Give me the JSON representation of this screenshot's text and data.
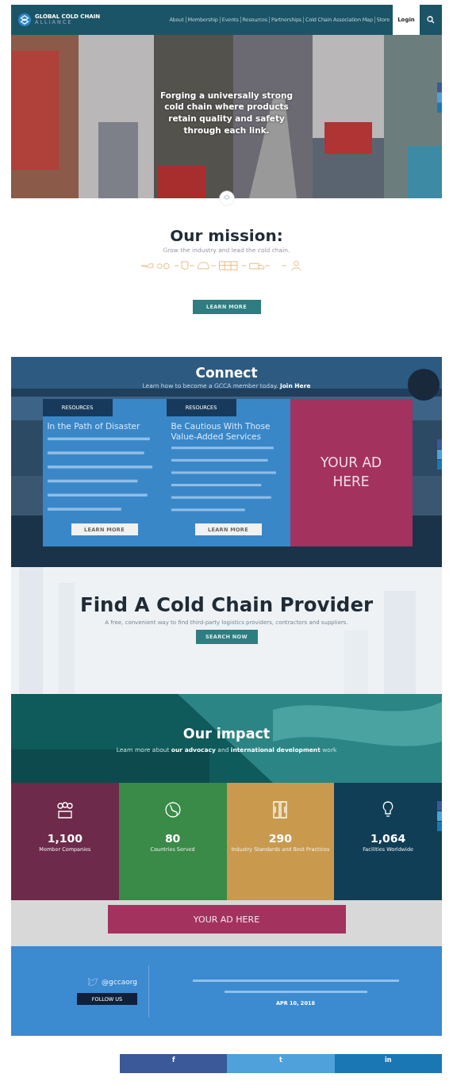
{
  "header": {
    "logo_line1": "GLOBAL COLD CHAIN",
    "logo_line2": "ALLIANCE",
    "nav": [
      "About",
      "Membership",
      "Events",
      "Resources",
      "Partnerships",
      "Cold Chain Association Map",
      "Store"
    ],
    "login": "Login"
  },
  "hero": {
    "kind": "picture",
    "tagline": "Forging a universally strong cold chain where products retain quality and safety through each link."
  },
  "mission": {
    "title": "Our mission:",
    "subtitle": "Grow the industry and lead the cold chain.",
    "button": "LEARN MORE"
  },
  "connect": {
    "title": "Connect",
    "subtitle": "Learn how to become a GCCA member today. **Join Here**",
    "cards": [
      {
        "kind": "article",
        "tag": "RESOURCES",
        "title": "In the Path of Disaster",
        "button": "LEARN MORE"
      },
      {
        "kind": "article",
        "tag": "RESOURCES",
        "title": "Be Cautious With Those Value-Added Services",
        "button": "LEARN MORE"
      },
      {
        "kind": "ad",
        "title": "YOUR AD HERE"
      }
    ]
  },
  "provider": {
    "title": "Find A Cold Chain Provider",
    "subtitle": "A free, convenient way to find third-party logistics providers, contractors and suppliers.",
    "button": "SEARCH NOW"
  },
  "impact": {
    "title": "Our impact",
    "subtitle": "Learn more about **our advocacy** and **international development** work",
    "stats": [
      {
        "value": "1,100",
        "label": "Member Companies",
        "color": "#6e2a4a"
      },
      {
        "value": "80",
        "label": "Countries Served",
        "color": "#3a8a48"
      },
      {
        "value": "290",
        "label": "Industry Standards and Best Practices",
        "color": "#c99a4e"
      },
      {
        "value": "1,064",
        "label": "Facilities Worldwide",
        "color": "#103e56"
      }
    ]
  },
  "ad_banner": "YOUR AD HERE",
  "twitter": {
    "handle": "@gccaorg",
    "follow": "FOLLOW US",
    "date": "APR 10, 2018"
  },
  "share": [
    "f",
    "t",
    "in"
  ]
}
